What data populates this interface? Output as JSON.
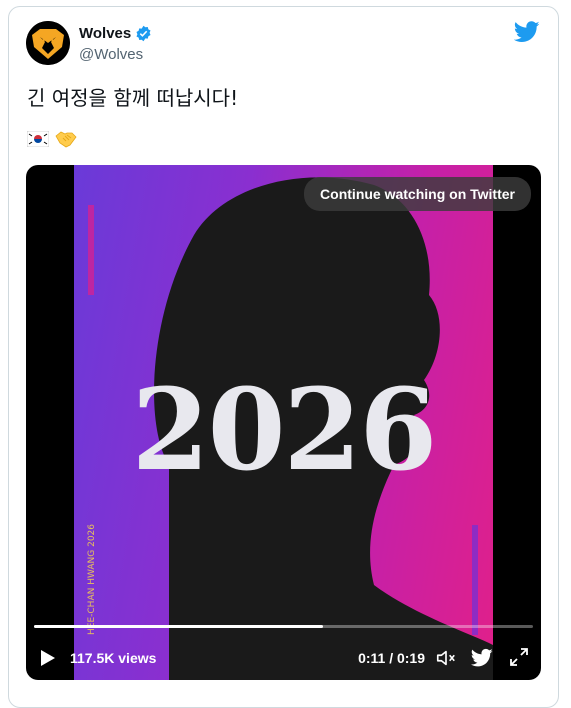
{
  "author": {
    "name": "Wolves",
    "handle": "@Wolves",
    "verified": true
  },
  "tweet": {
    "text": "긴 여정을 함께 떠납시다!",
    "emojis": [
      "kr-flag-icon",
      "handshake-icon"
    ]
  },
  "media": {
    "continue_label": "Continue watching on Twitter",
    "poster_year": "2026",
    "views": "117.5K views",
    "time": "0:11 / 0:19",
    "progress": 0.58
  },
  "colors": {
    "twitter_blue": "#1d9bf0",
    "poster_left": "#6a3ad8",
    "poster_right": "#e0208a"
  }
}
